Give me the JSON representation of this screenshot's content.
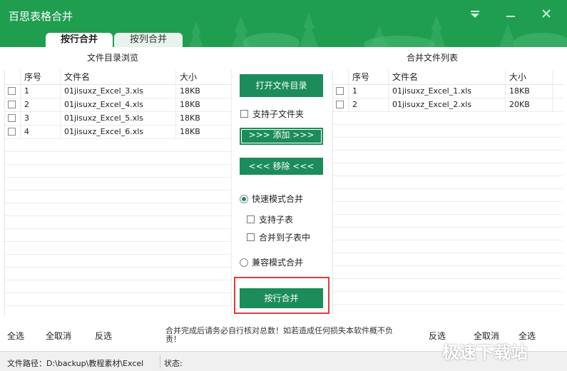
{
  "app": {
    "title": "百思表格合并"
  },
  "tabs": [
    {
      "label": "按行合并"
    },
    {
      "label": "按列合并"
    }
  ],
  "left_panel": {
    "title": "文件目录浏览",
    "columns": [
      "序号",
      "文件名",
      "大小"
    ],
    "rows": [
      {
        "index": "1",
        "name": "01jisuxz_Excel_3.xls",
        "size": "18KB"
      },
      {
        "index": "2",
        "name": "01jisuxz_Excel_4.xls",
        "size": "18KB"
      },
      {
        "index": "3",
        "name": "01jisuxz_Excel_5.xls",
        "size": "18KB"
      },
      {
        "index": "4",
        "name": "01jisuxz_Excel_6.xls",
        "size": "18KB"
      }
    ]
  },
  "right_panel": {
    "title": "合并文件列表",
    "columns": [
      "序号",
      "文件名",
      "大小"
    ],
    "rows": [
      {
        "index": "1",
        "name": "01jisuxz_Excel_1.xls",
        "size": "18KB"
      },
      {
        "index": "2",
        "name": "01jisuxz_Excel_2.xls",
        "size": "20KB"
      }
    ]
  },
  "controls": {
    "open_dir": "打开文件目录",
    "include_subfolders": "支持子文件夹",
    "add": ">>> 添加 >>>",
    "remove": "<<< 移除 <<<",
    "fast_mode": "快速模式合并",
    "support_subsheet": "支持子表",
    "merge_to_subsheet": "合并到子表中",
    "compat_mode": "兼容模式合并",
    "merge_button": "按行合并"
  },
  "bottom": {
    "select_all_left": "全选",
    "deselect_left": "全取消",
    "invert_left": "反选",
    "notice": "合并完成后请务必自行核对总数！如若造成任何损失本软件概不负责！",
    "invert_right": "反选",
    "deselect_right": "全取消",
    "select_all_right": "全选"
  },
  "statusbar": {
    "path_label": "文件路径：D:\\backup\\教程素材\\Excel",
    "status_label": "状态:"
  },
  "watermark": "极速下载站",
  "colors": {
    "title_bar": "#1f9e50",
    "button": "#1b8c5a",
    "highlight": "#e23b3b"
  }
}
